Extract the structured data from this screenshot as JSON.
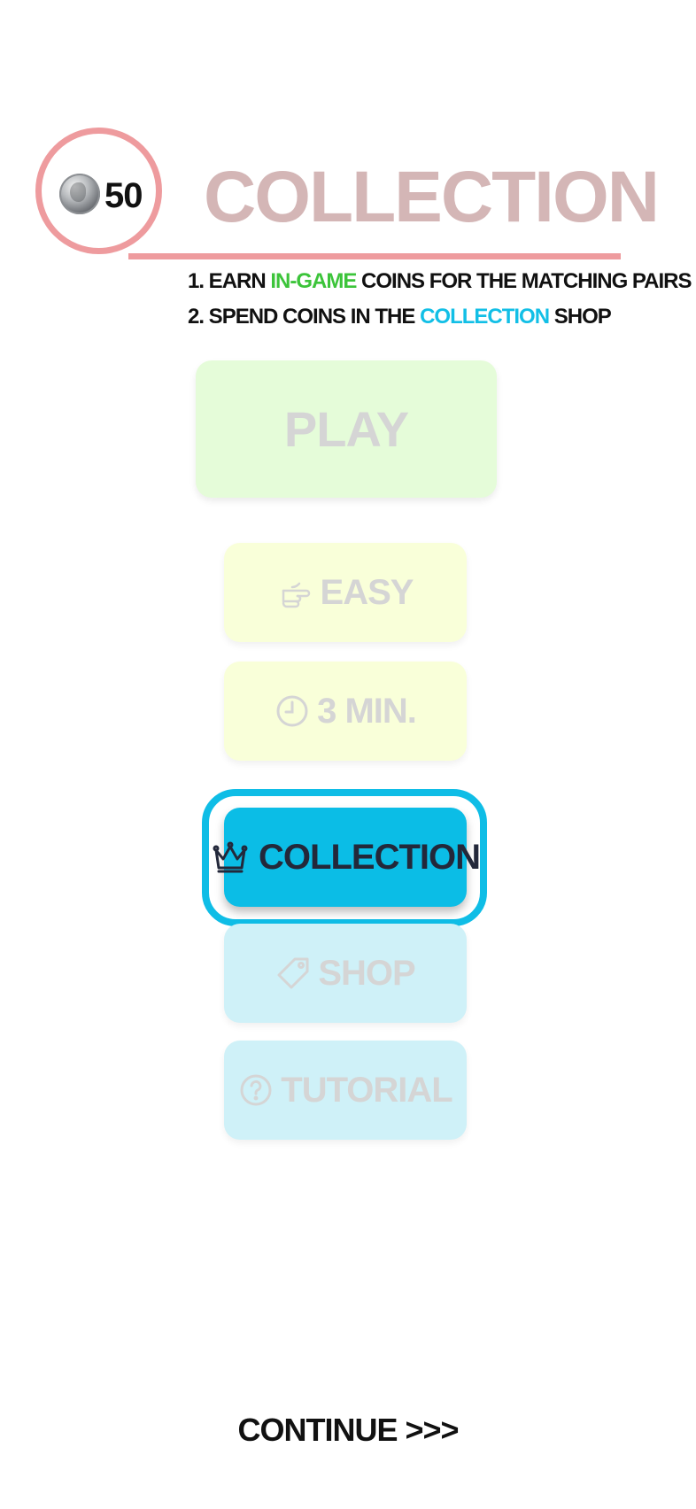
{
  "header": {
    "coin_count": "50",
    "coin_icon": "silver-coin-icon",
    "title": "COLLECTION"
  },
  "instructions": {
    "line1": {
      "prefix": "1.  EARN ",
      "highlight": "IN-GAME",
      "suffix": " COINS FOR THE MATCHING PAIRS"
    },
    "line2": {
      "prefix": "2. SPEND COINS IN THE ",
      "highlight": "COLLECTION",
      "suffix": " SHOP"
    }
  },
  "menu": {
    "play_label": "PLAY",
    "difficulty": {
      "label": "EASY",
      "icon": "pointing-hand-icon"
    },
    "time": {
      "label": "3 MIN.",
      "icon": "clock-icon"
    },
    "collection": {
      "label": "COLLECTION",
      "icon": "crown-icon"
    },
    "shop": {
      "label": "SHOP",
      "icon": "tag-icon"
    },
    "tutorial": {
      "label": "TUTORIAL",
      "icon": "question-circle-icon"
    }
  },
  "footer": {
    "continue_label": "CONTINUE >>>"
  },
  "colors": {
    "accent_pink": "#ee9b9e",
    "title_muted": "#d4b6b6",
    "green": "#3cc43a",
    "blue": "#0bbde6",
    "play_bg": "#e5fcd9",
    "yellow_bg": "#f9ffd9",
    "light_blue_bg": "#cff1f8",
    "dark_text": "#23283a"
  }
}
